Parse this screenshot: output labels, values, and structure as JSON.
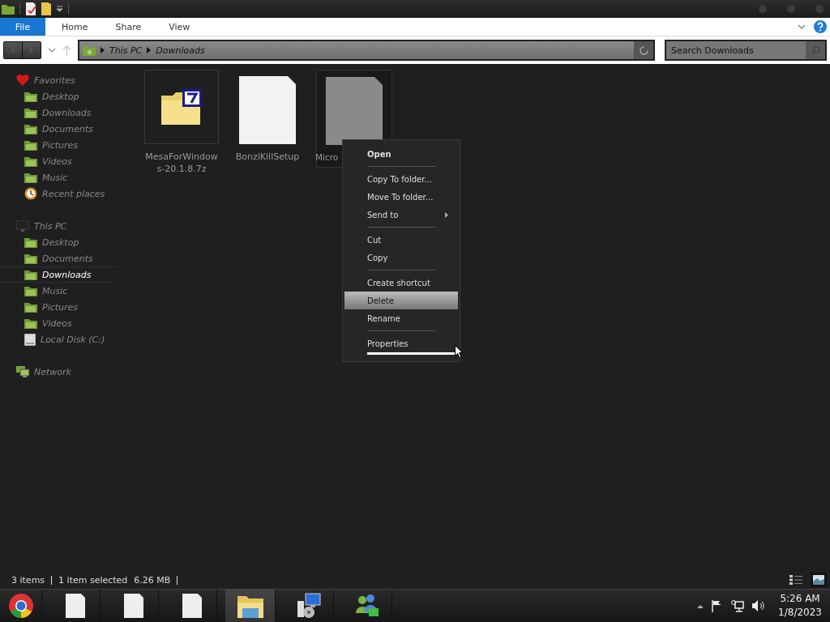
{
  "ribbon": {
    "tabs": [
      {
        "label": "File",
        "selected": true
      },
      {
        "label": "Home",
        "selected": false
      },
      {
        "label": "Share",
        "selected": false
      },
      {
        "label": "View",
        "selected": false
      }
    ]
  },
  "address": {
    "path": [
      "This PC",
      "Downloads"
    ]
  },
  "search": {
    "placeholder": "Search Downloads"
  },
  "sidebar": {
    "sections": [
      {
        "label": "Favorites",
        "kind": "favorites",
        "children": [
          {
            "label": "Desktop",
            "kind": "folder",
            "selected": false
          },
          {
            "label": "Downloads",
            "kind": "folder",
            "selected": false
          },
          {
            "label": "Documents",
            "kind": "folder",
            "selected": false
          },
          {
            "label": "Pictures",
            "kind": "folder",
            "selected": false
          },
          {
            "label": "Videos",
            "kind": "folder",
            "selected": false
          },
          {
            "label": "Music",
            "kind": "folder",
            "selected": false
          },
          {
            "label": "Recent places",
            "kind": "recent",
            "selected": false
          }
        ]
      },
      {
        "label": "This PC",
        "kind": "computer",
        "children": [
          {
            "label": "Desktop",
            "kind": "folder",
            "selected": false
          },
          {
            "label": "Documents",
            "kind": "folder",
            "selected": false
          },
          {
            "label": "Downloads",
            "kind": "folder",
            "selected": true
          },
          {
            "label": "Music",
            "kind": "folder",
            "selected": false
          },
          {
            "label": "Pictures",
            "kind": "folder",
            "selected": false
          },
          {
            "label": "Videos",
            "kind": "folder",
            "selected": false
          },
          {
            "label": "Local Disk (C:)",
            "kind": "drive",
            "selected": false
          }
        ]
      },
      {
        "label": "Network",
        "kind": "network"
      }
    ]
  },
  "files": [
    {
      "name": [
        "MesaForWindow",
        "s-20.1.8.7z"
      ],
      "kind": "archive",
      "selected": false
    },
    {
      "name": [
        "BonziKillSetup"
      ],
      "kind": "document",
      "selected": false
    },
    {
      "name": [
        "Micro"
      ],
      "kind": "document-grey",
      "selected": true
    }
  ],
  "context_menu": {
    "groups": [
      [
        {
          "label": "Open",
          "default": true,
          "selected": false,
          "submenu": false
        }
      ],
      [
        {
          "label": "Copy To folder...",
          "default": false,
          "selected": false,
          "submenu": false
        },
        {
          "label": "Move To folder...",
          "default": false,
          "selected": false,
          "submenu": false
        },
        {
          "label": "Send to",
          "default": false,
          "selected": false,
          "submenu": true
        }
      ],
      [
        {
          "label": "Cut",
          "default": false,
          "selected": false,
          "submenu": false
        },
        {
          "label": "Copy",
          "default": false,
          "selected": false,
          "submenu": false
        }
      ],
      [
        {
          "label": "Create shortcut",
          "default": false,
          "selected": false,
          "submenu": false
        },
        {
          "label": "Delete",
          "default": false,
          "selected": true,
          "submenu": false
        },
        {
          "label": "Rename",
          "default": false,
          "selected": false,
          "submenu": false
        }
      ],
      [
        {
          "label": "Properties",
          "default": false,
          "selected": false,
          "submenu": false
        }
      ]
    ]
  },
  "status_bar": {
    "count": "3 items",
    "selection": "1 item selected",
    "size": "6.26 MB"
  },
  "taskbar": {
    "buttons": [
      {
        "kind": "browser",
        "selected": false
      },
      {
        "kind": "document",
        "selected": false
      },
      {
        "kind": "document",
        "selected": false
      },
      {
        "kind": "document",
        "selected": false
      },
      {
        "kind": "folder",
        "selected": true
      },
      {
        "kind": "installer",
        "selected": false
      },
      {
        "kind": "people",
        "selected": false
      }
    ],
    "clock": {
      "time": "5:26 AM",
      "date": "1/8/2023"
    }
  }
}
